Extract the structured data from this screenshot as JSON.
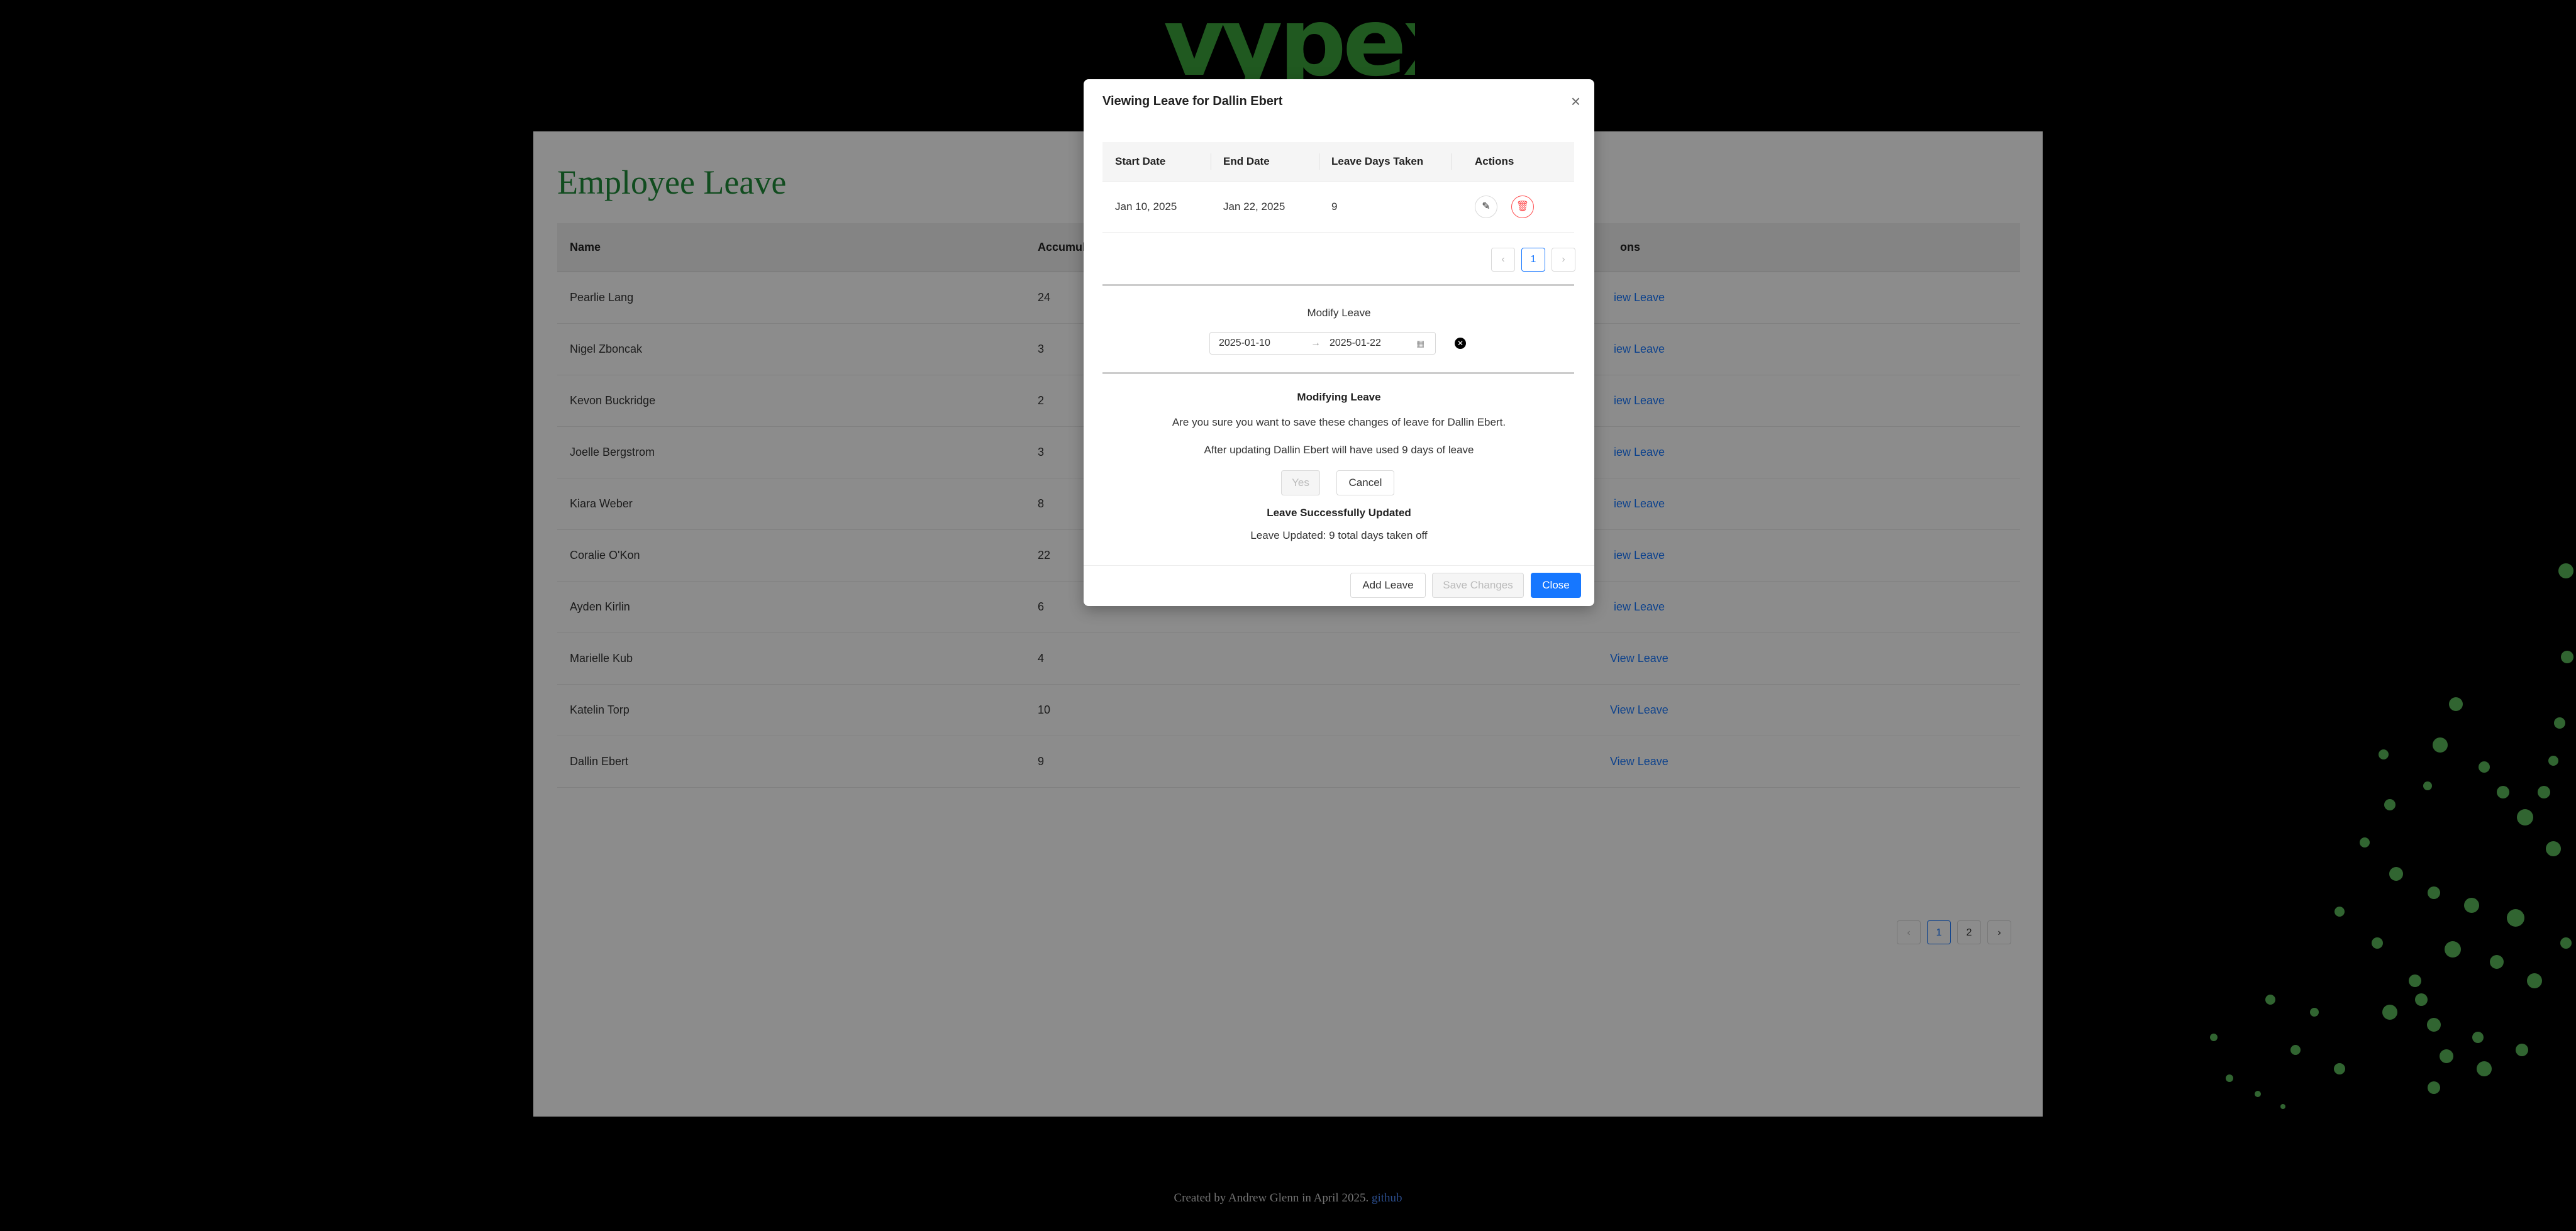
{
  "logo": {
    "text": "vypex"
  },
  "page": {
    "title": "Employee Leave",
    "columns": [
      "Name",
      "Accumula",
      "ons"
    ],
    "rows": [
      {
        "name": "Pearlie Lang",
        "accumulated": "24",
        "action": "iew Leave"
      },
      {
        "name": "Nigel Zboncak",
        "accumulated": "3",
        "action": "iew Leave"
      },
      {
        "name": "Kevon Buckridge",
        "accumulated": "2",
        "action": "iew Leave"
      },
      {
        "name": "Joelle Bergstrom",
        "accumulated": "3",
        "action": "iew Leave"
      },
      {
        "name": "Kiara Weber",
        "accumulated": "8",
        "action": "iew Leave"
      },
      {
        "name": "Coralie O'Kon",
        "accumulated": "22",
        "action": "iew Leave"
      },
      {
        "name": "Ayden Kirlin",
        "accumulated": "6",
        "action": "iew Leave"
      },
      {
        "name": "Marielle Kub",
        "accumulated": "4",
        "action": "View Leave"
      },
      {
        "name": "Katelin Torp",
        "accumulated": "10",
        "action": "View Leave"
      },
      {
        "name": "Dallin Ebert",
        "accumulated": "9",
        "action": "View Leave"
      }
    ],
    "pagination": {
      "prev": "‹",
      "pages": [
        "1",
        "2"
      ],
      "next": "›"
    }
  },
  "footer": {
    "text": "Created by Andrew Glenn in April 2025.",
    "link": "github"
  },
  "modal": {
    "title": "Viewing Leave for Dallin Ebert",
    "close_icon": "×",
    "table": {
      "headers": [
        "Start Date",
        "End Date",
        "Leave Days Taken",
        "Actions"
      ],
      "row": {
        "start": "Jan 10, 2025",
        "end": "Jan 22, 2025",
        "days": "9"
      }
    },
    "pagination": {
      "prev": "‹",
      "page": "1",
      "next": "›"
    },
    "modify_label": "Modify Leave",
    "range": {
      "start": "2025-01-10",
      "arrow": "→",
      "end": "2025-01-22"
    },
    "confirm_title": "Modifying Leave",
    "confirm_text": "Are you sure you want to save these changes of leave for Dallin Ebert.",
    "confirm_text2": "After updating Dallin Ebert will have used 9 days of leave",
    "yes_label": "Yes",
    "cancel_label": "Cancel",
    "success_title": "Leave Successfully Updated",
    "success_text": "Leave Updated: 9 total days taken off",
    "footer_buttons": {
      "add": "Add Leave",
      "save": "Save Changes",
      "close": "Close"
    }
  },
  "colors": {
    "brand_green": "#1f8a3a",
    "logo_green": "#3ba33b",
    "primary": "#1677ff",
    "danger": "#ff4d4f"
  }
}
